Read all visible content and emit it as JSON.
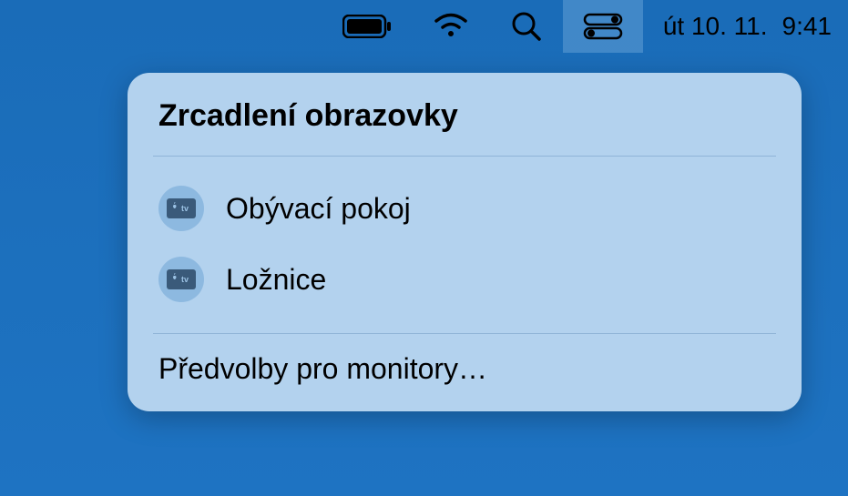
{
  "menubar": {
    "date": "út 10. 11.",
    "time": "9:41"
  },
  "popover": {
    "title": "Zrcadlení obrazovky",
    "devices": [
      {
        "label": "Obývací pokoj",
        "icon": "appletv"
      },
      {
        "label": "Ložnice",
        "icon": "appletv"
      }
    ],
    "prefs_label": "Předvolby pro monitory…"
  }
}
